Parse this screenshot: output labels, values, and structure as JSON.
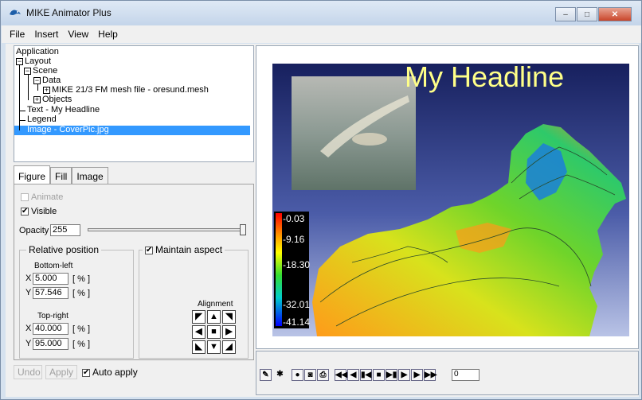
{
  "window": {
    "title": "MIKE Animator Plus",
    "minimize": "–",
    "maximize": "□",
    "close": "✕"
  },
  "menu": {
    "file": "File",
    "insert": "Insert",
    "view": "View",
    "help": "Help"
  },
  "tree": {
    "application": "Application",
    "layout": "Layout",
    "scene": "Scene",
    "data": "Data",
    "mesh_file": "MIKE 21/3 FM mesh file - oresund.mesh",
    "objects": "Objects",
    "text_item": "Text - My Headline",
    "legend_item": "Legend",
    "image_item": "Image - CoverPic.jpg",
    "expand_minus": "−",
    "expand_plus": "+"
  },
  "tabs": {
    "figure": "Figure",
    "fill": "Fill",
    "image": "Image"
  },
  "figure": {
    "animate_label": "Animate",
    "animate_checked": false,
    "visible_label": "Visible",
    "visible_checked": true,
    "opacity_label": "Opacity",
    "opacity_value": "255",
    "relative_position_label": "Relative position",
    "maintain_aspect_label": "Maintain aspect",
    "maintain_aspect_checked": true,
    "bottom_left_label": "Bottom-left",
    "top_right_label": "Top-right",
    "x_label": "X",
    "y_label": "Y",
    "percent_unit": "[ % ]",
    "bl_x": "5.000",
    "bl_y": "57.546",
    "tr_x": "40.000",
    "tr_y": "95.000",
    "alignment_label": "Alignment"
  },
  "bottom": {
    "undo": "Undo",
    "apply": "Apply",
    "auto_apply": "Auto apply",
    "auto_apply_checked": true,
    "check_mark": "✔"
  },
  "scene": {
    "headline": "My Headline",
    "legend_values": [
      "-0.03",
      "-9.16",
      "-18.30",
      "-32.01",
      "-41.14"
    ]
  },
  "player": {
    "frame_value": "0"
  }
}
